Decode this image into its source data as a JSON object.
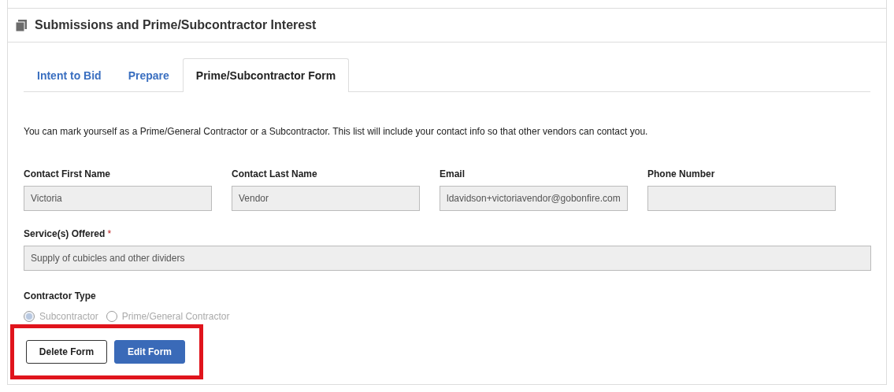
{
  "panel": {
    "title": "Submissions and Prime/Subcontractor Interest"
  },
  "tabs": [
    {
      "label": "Intent to Bid",
      "selected": false
    },
    {
      "label": "Prepare",
      "selected": false
    },
    {
      "label": "Prime/Subcontractor Form",
      "selected": true
    }
  ],
  "intro": "You can mark yourself as a Prime/General Contractor or a Subcontractor. This list will include your contact info so that other vendors can contact you.",
  "fields": [
    {
      "label": "Contact First Name",
      "value": "Victoria",
      "disabled": true
    },
    {
      "label": "Contact Last Name",
      "value": "Vendor",
      "disabled": true
    },
    {
      "label": "Email",
      "value": "ldavidson+victoriavendor@gobonfire.com",
      "disabled": true
    },
    {
      "label": "Phone Number",
      "disabled": true
    }
  ],
  "services": {
    "label": "Service(s) Offered",
    "required_mark": "*",
    "value": "Supply of cubicles and other dividers",
    "disabled": true
  },
  "contractor_type": {
    "label": "Contractor Type",
    "disabled": true,
    "options": [
      {
        "label": "Subcontractor",
        "selected": true
      },
      {
        "label": "Prime/General Contractor",
        "selected": false
      }
    ]
  },
  "actions": {
    "highlighted": true,
    "buttons": [
      {
        "label": "Delete Form",
        "kind": "secondary"
      },
      {
        "label": "Edit Form",
        "kind": "primary"
      }
    ]
  }
}
